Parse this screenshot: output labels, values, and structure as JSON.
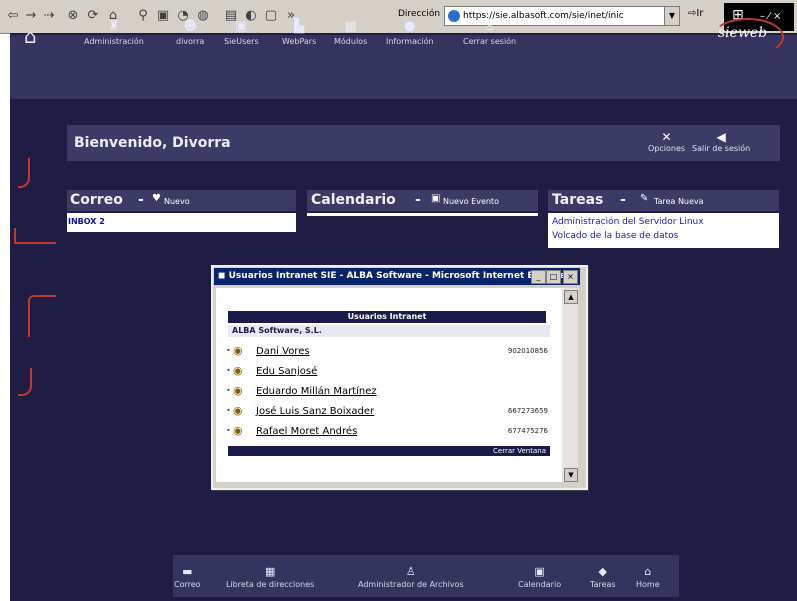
{
  "browser": {
    "address_label": "Dirección",
    "url": "https://sie.albasoft.com/sie/inet/inic",
    "go_label": "Ir",
    "icons": [
      "back-icon",
      "forward-icon",
      "stop-icon",
      "refresh-icon",
      "home-icon",
      "search-icon",
      "favorites-icon",
      "history-icon",
      "mail-icon",
      "print-icon",
      "edit-icon",
      "discuss-icon"
    ]
  },
  "topnav": {
    "items": [
      {
        "label": "Administración",
        "icon": "admin-icon"
      },
      {
        "label": "divorra",
        "icon": "user-icon"
      },
      {
        "label": "SieUsers",
        "icon": "users-icon"
      },
      {
        "label": "WebPars",
        "icon": "webpars-icon"
      },
      {
        "label": "Módulos",
        "icon": "modules-icon"
      },
      {
        "label": "Información",
        "icon": "info-icon"
      },
      {
        "label": "Cerrar sesión",
        "icon": "logout-icon"
      }
    ],
    "brand": "sieweb"
  },
  "welcome": {
    "text": "Bienvenido, Divorra",
    "options_label": "Opciones",
    "logout_label": "Salir de sesión"
  },
  "correo": {
    "title": "Correo",
    "new_label": "Nuevo",
    "inbox_label": "INBOX",
    "inbox_count": "2"
  },
  "calendario": {
    "title": "Calendario",
    "new_label": "Nuevo Evento"
  },
  "tareas": {
    "title": "Tareas",
    "new_label": "Tarea Nueva",
    "items": [
      "Administración del Servidor Linux",
      "Volcado de la base de datos"
    ]
  },
  "popup": {
    "title": "Usuarios Intranet SIE - ALBA Software - Microsoft Internet Explorer",
    "list_header": "Usuarios Intranet",
    "company": "ALBA Software, S.L.",
    "users": [
      {
        "name": "Dani Vores",
        "phone": "902010856"
      },
      {
        "name": "Edu Sanjosé",
        "phone": ""
      },
      {
        "name": "Eduardo Millán Martínez",
        "phone": ""
      },
      {
        "name": "José Luis Sanz Boixader",
        "phone": "667273659"
      },
      {
        "name": "Rafael Moret Andrés",
        "phone": "677475276"
      }
    ],
    "footer": "Cerrar Ventana"
  },
  "bottomnav": {
    "items": [
      {
        "label": "Correo",
        "icon": "mail-icon"
      },
      {
        "label": "Libreta de direcciones",
        "icon": "addressbook-icon"
      },
      {
        "label": "Administrador de Archivos",
        "icon": "filemanager-icon"
      },
      {
        "label": "Calendario",
        "icon": "calendar-icon"
      },
      {
        "label": "Tareas",
        "icon": "tasks-icon"
      },
      {
        "label": "Home",
        "icon": "home-icon"
      }
    ]
  },
  "colors": {
    "app_bg": "#1f1d43",
    "bar_bg": "#3b3b66",
    "nav_bg": "#34345e",
    "accent_red": "#c0392b",
    "link_blue": "#1a1ab0"
  }
}
